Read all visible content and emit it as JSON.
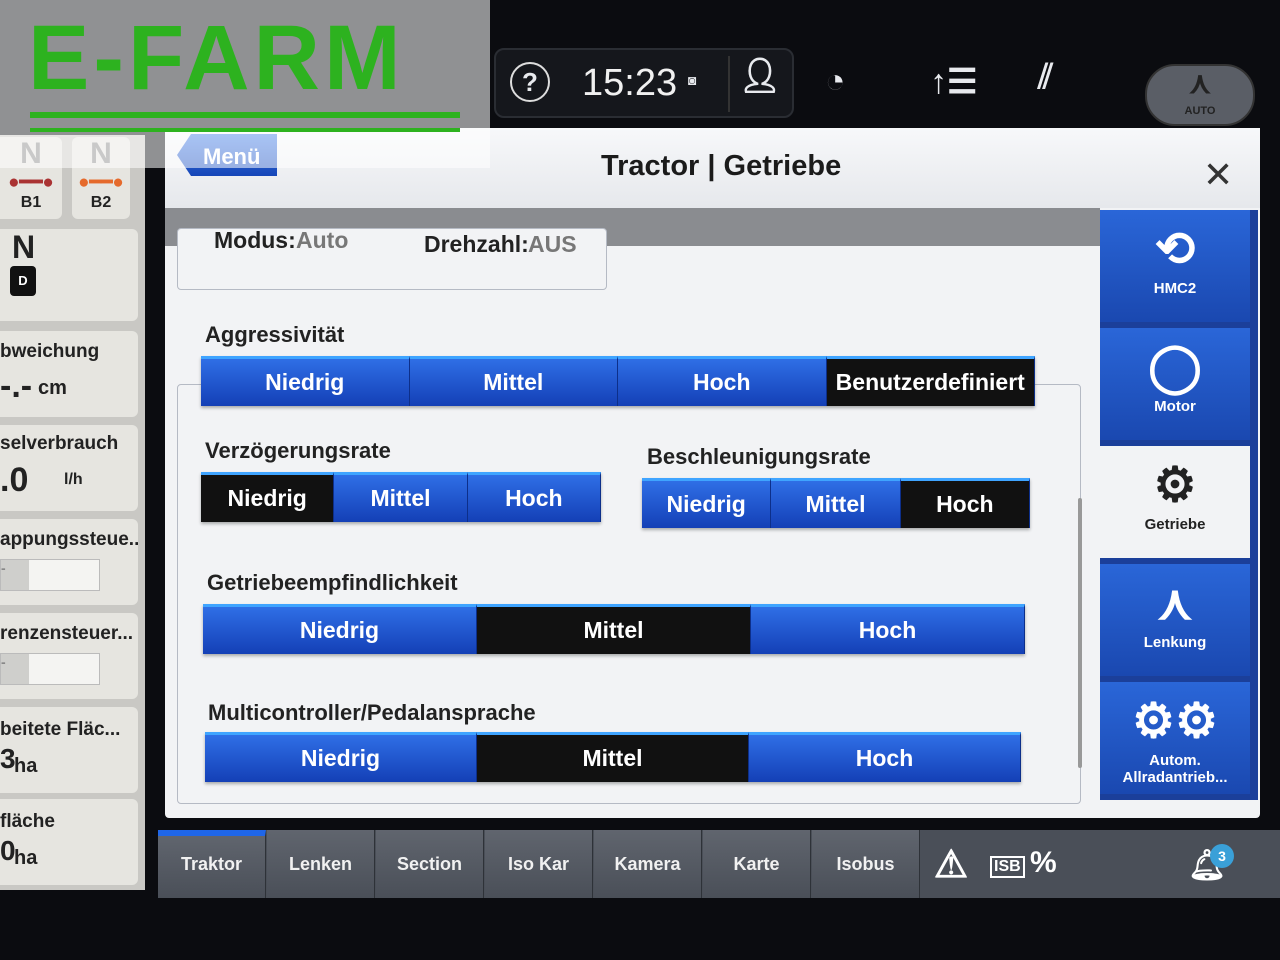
{
  "watermark": {
    "logo_text": "E-FARM"
  },
  "topbar": {
    "help_icon": "question-icon",
    "time": "15:23",
    "icons": [
      "camera-icon",
      "user-icon",
      "speedometer-icon",
      "hitch-icon",
      "field-icon"
    ],
    "auto_label": "AUTO"
  },
  "left_panel": {
    "b1": {
      "gear": "N",
      "label": "B1"
    },
    "b2": {
      "gear": "N",
      "label": "B2"
    },
    "drive": {
      "gear": "N",
      "mode": "D"
    },
    "cards": [
      {
        "title": "bweichung",
        "value": "-.-",
        "unit": "cm"
      },
      {
        "title": "selverbrauch",
        "value": ".0",
        "unit": "l/h"
      },
      {
        "title": "appungssteue...",
        "value": "-"
      },
      {
        "title": "renzensteuer...",
        "value": "-"
      },
      {
        "title": "beitete Fläc...",
        "value": "3",
        "unit": "ha"
      },
      {
        "title": "fläche",
        "value": "0",
        "unit": "ha"
      }
    ]
  },
  "dialog": {
    "menu_label": "Menü",
    "title": "Tractor | Getriebe",
    "status": {
      "modus_label": "Modus:",
      "modus_value": "Auto",
      "drehzahl_label": "Drehzahl:",
      "drehzahl_value": "AUS"
    },
    "groups": [
      {
        "label": "Aggressivität",
        "options": [
          "Niedrig",
          "Mittel",
          "Hoch",
          "Benutzerdefiniert"
        ],
        "selected": "Benutzerdefiniert"
      },
      {
        "label": "Verzögerungsrate",
        "options": [
          "Niedrig",
          "Mittel",
          "Hoch"
        ],
        "selected": "Niedrig"
      },
      {
        "label": "Beschleunigungsrate",
        "options": [
          "Niedrig",
          "Mittel",
          "Hoch"
        ],
        "selected": "Hoch"
      },
      {
        "label": "Getriebeempfindlichkeit",
        "options": [
          "Niedrig",
          "Mittel",
          "Hoch"
        ],
        "selected": "Mittel"
      },
      {
        "label": "Multicontroller/Pedalansprache",
        "options": [
          "Niedrig",
          "Mittel",
          "Hoch"
        ],
        "selected": "Mittel"
      }
    ]
  },
  "right_nav": [
    {
      "label": "HMC2",
      "icon": "hmc2-icon"
    },
    {
      "label": "Motor",
      "icon": "engine-icon"
    },
    {
      "label": "Getriebe",
      "icon": "gear-icon",
      "selected": true
    },
    {
      "label": "Lenkung",
      "icon": "steering-icon"
    },
    {
      "label": "Autom. Allradantrieb...",
      "icon": "4wd-icon"
    }
  ],
  "bottom_tabs": [
    {
      "label": "Traktor",
      "selected": true
    },
    {
      "label": "Lenken"
    },
    {
      "label": "Section"
    },
    {
      "label": "Iso Kar"
    },
    {
      "label": "Kamera"
    },
    {
      "label": "Karte"
    },
    {
      "label": "Isobus"
    }
  ],
  "status_icons": {
    "isb_label": "ISB",
    "notification_count": "3"
  },
  "colors": {
    "accent_blue": "#1f5fd8",
    "selected": "#111111"
  }
}
